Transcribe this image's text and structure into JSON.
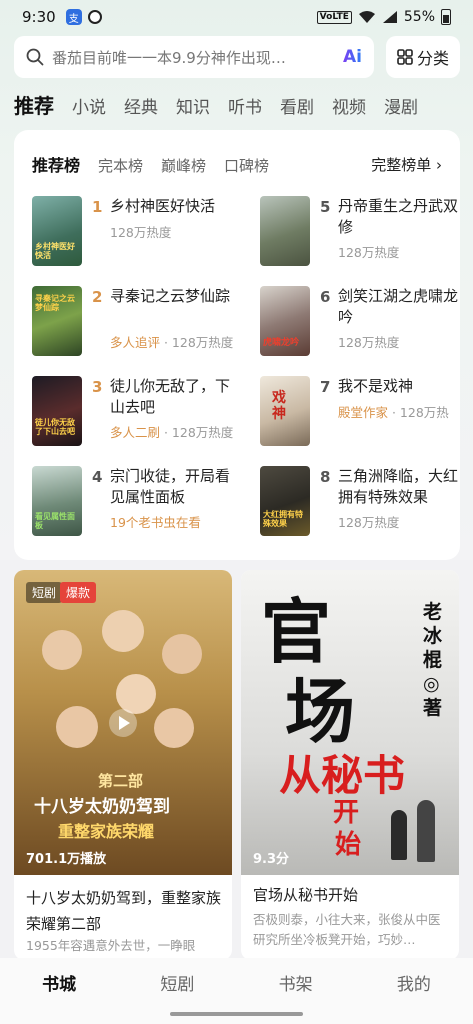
{
  "status": {
    "time": "9:30",
    "network": "VoLTE",
    "battery": "55%"
  },
  "search": {
    "placeholder": "番茄目前唯一一本9.9分神作出现…",
    "ai_label": "Ai"
  },
  "category_button": "分类",
  "tabs": [
    "推荐",
    "小说",
    "经典",
    "知识",
    "听书",
    "看剧",
    "视频",
    "漫剧"
  ],
  "ranking": {
    "subtabs": [
      "推荐榜",
      "完本榜",
      "巅峰榜",
      "口碑榜"
    ],
    "full_list": "完整榜单 ›",
    "items": [
      {
        "rank": "1",
        "title": "乡村神医好快活",
        "meta_hl": "",
        "meta": "128万热度",
        "cover_text": "乡村神医好快活"
      },
      {
        "rank": "2",
        "title": "寻秦记之云梦仙踪",
        "meta_hl": "多人追评",
        "meta": " · 128万热度",
        "cover_text": "寻秦记之云梦仙踪"
      },
      {
        "rank": "3",
        "title": "徒儿你无敌了，下山去吧",
        "meta_hl": "多人二刷",
        "meta": " · 128万热度",
        "cover_text": "徒儿你无敌了下山去吧"
      },
      {
        "rank": "4",
        "title": "宗门收徒，开局看见属性面板",
        "meta_hl": "19个老书虫在看",
        "meta": "",
        "cover_text": "看见属性面板"
      },
      {
        "rank": "5",
        "title": "丹帝重生之丹武双修",
        "meta_hl": "",
        "meta": "128万热度",
        "cover_text": ""
      },
      {
        "rank": "6",
        "title": "剑笑江湖之虎啸龙吟",
        "meta_hl": "",
        "meta": "128万热度",
        "cover_text": "虎啸龙吟"
      },
      {
        "rank": "7",
        "title": "我不是戏神",
        "meta_hl": "殿堂作家",
        "meta": " · 128万热",
        "cover_text": "戏神"
      },
      {
        "rank": "8",
        "title": "三角洲降临，大红拥有特殊效果",
        "meta_hl": "",
        "meta": "128万热度",
        "cover_text": "大红拥有特殊效果"
      }
    ]
  },
  "feed": [
    {
      "badge1": "短剧",
      "badge2": "爆款",
      "plays": "701.1万播放",
      "title": "十八岁太奶奶驾到，重整家族荣耀第二部",
      "desc": "1955年容遇意外去世，一睁眼",
      "poster_line1": "第二部",
      "poster_line2": "十八岁太奶奶驾到",
      "poster_line3": "重整家族荣耀"
    },
    {
      "score": "9.3分",
      "title": "官场从秘书开始",
      "desc": "否极则泰，小往大来，张俊从中医研究所坐冷板凳开始，巧妙…",
      "poster_big1": "官",
      "poster_big2": "场",
      "poster_red": "从秘书",
      "poster_red2": "开",
      "poster_red3": "始",
      "poster_author": "老冰棍◎著"
    }
  ],
  "bottom_nav": [
    "书城",
    "短剧",
    "书架",
    "我的"
  ],
  "colors": {
    "accent_orange": "#d9934a",
    "badge_red": "#e5443a"
  }
}
